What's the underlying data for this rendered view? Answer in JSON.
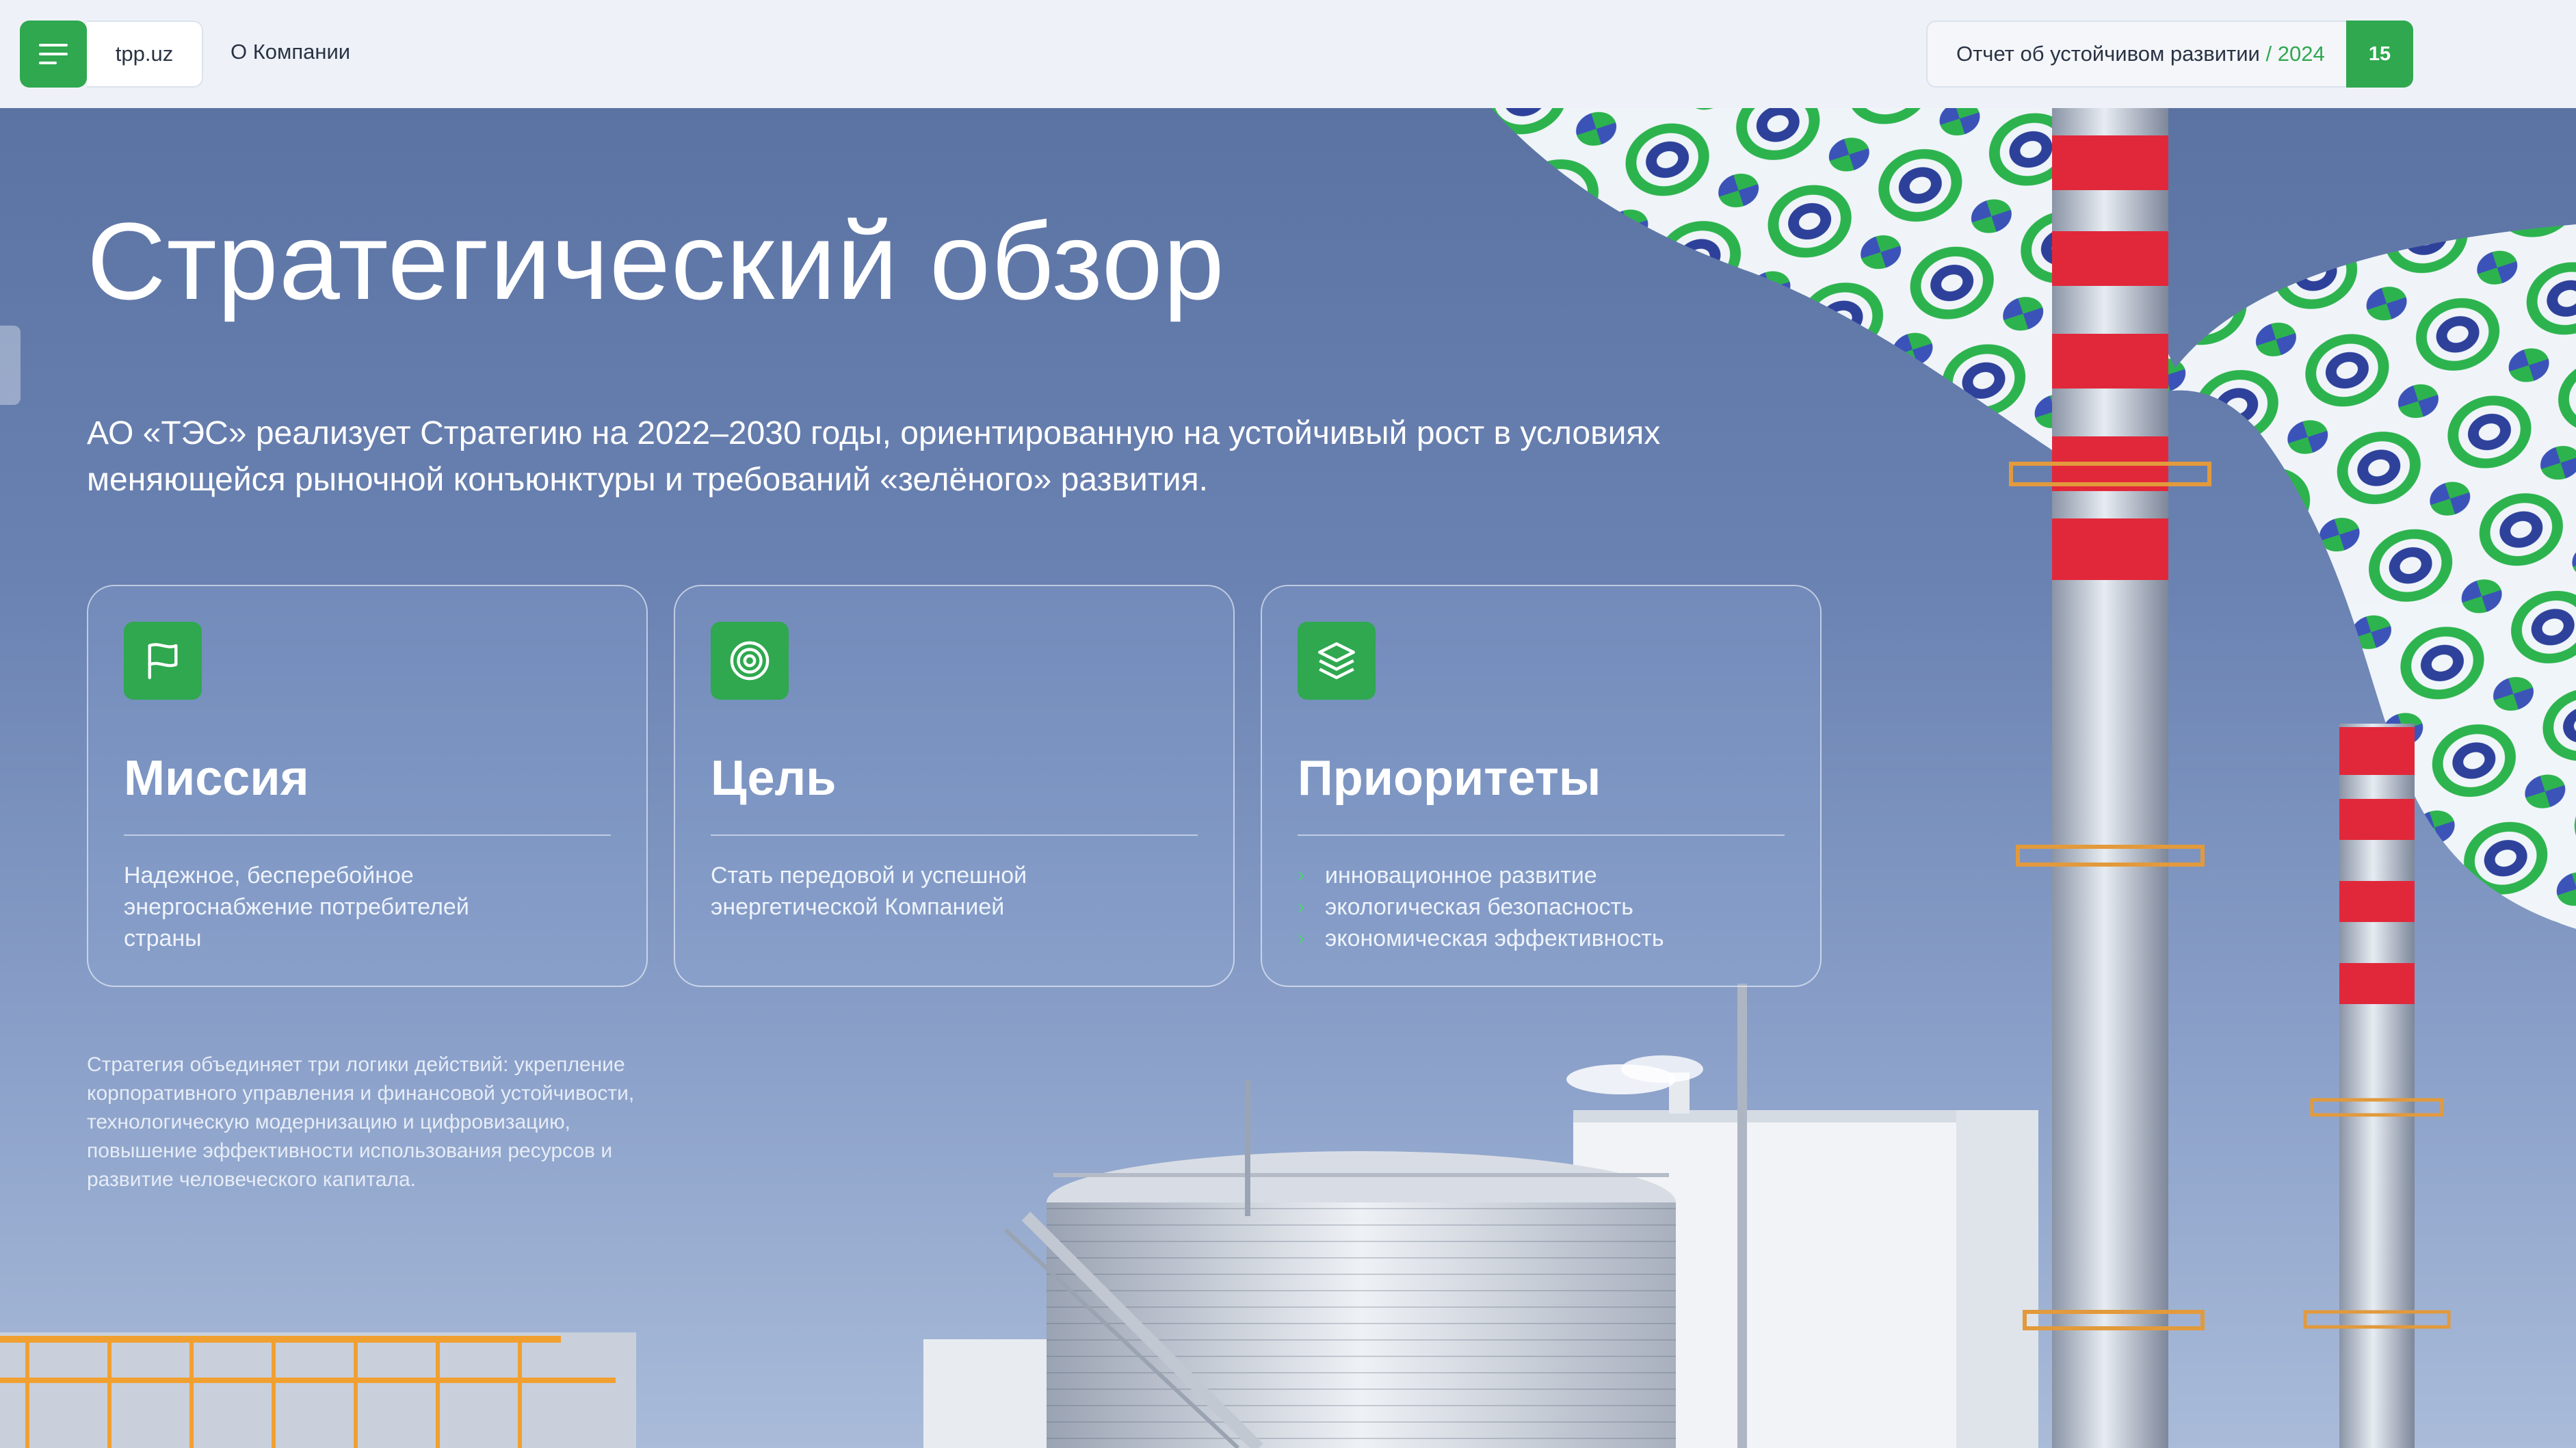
{
  "header": {
    "site": "tpp.uz",
    "nav_about": "О Компании",
    "report_title": "Отчет об устойчивом развитии",
    "report_separator": " / ",
    "report_year": "2024",
    "page_number": "15"
  },
  "hero": {
    "title": "Стратегический обзор",
    "lead": "АО «ТЭС» реализует Стратегию на 2022–2030 годы, ориентированную на устойчивый рост в условиях меняющейся рыночной конъюнктуры и требований «зелёного» развития."
  },
  "cards": [
    {
      "icon": "flag-icon",
      "title": "Миссия",
      "text": "Надежное, бесперебойное энергоснабжение потребителей страны"
    },
    {
      "icon": "target-icon",
      "title": "Цель",
      "text": "Стать передовой и успешной энергетической Компанией"
    },
    {
      "icon": "layers-icon",
      "title": "Приоритеты",
      "items": [
        "инновационное развитие",
        "экологическая безопасность",
        "экономическая эффективность"
      ]
    }
  ],
  "note": "Стратегия объединяет три логики действий: укрепление корпоративного управления и финансовой устойчивости, технологическую модернизацию и цифровизацию, повышение эффективности использования ресурсов и развитие человеческого капитала.",
  "colors": {
    "accent": "#2fa84f",
    "topbar": "#eef2f8",
    "sky": "#6a82b2"
  }
}
